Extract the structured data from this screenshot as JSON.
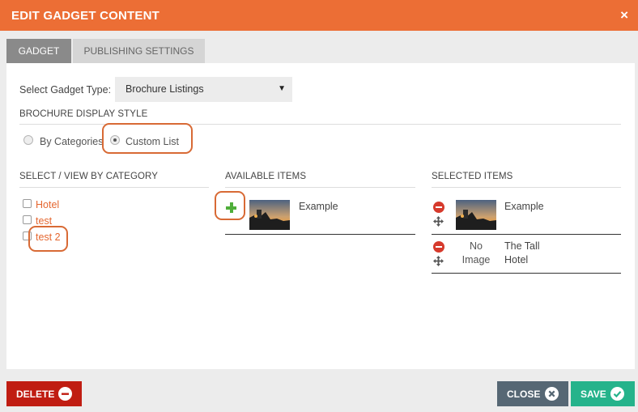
{
  "dialog": {
    "title": "EDIT GADGET CONTENT",
    "close_icon": "×"
  },
  "tabs": [
    {
      "label": "GADGET",
      "active": true
    },
    {
      "label": "PUBLISHING SETTINGS",
      "active": false
    }
  ],
  "gadget_type": {
    "label": "Select Gadget Type:",
    "value": "Brochure Listings"
  },
  "display_style": {
    "title": "BROCHURE DISPLAY STYLE",
    "options": [
      {
        "label": "By Categories",
        "checked": false
      },
      {
        "label": "Custom List",
        "checked": true
      }
    ]
  },
  "categories": {
    "title": "SELECT / VIEW BY CATEGORY",
    "items": [
      {
        "label": "Hotel",
        "checked": false
      },
      {
        "label": "test",
        "checked": false
      },
      {
        "label": "test 2",
        "checked": false
      }
    ]
  },
  "available": {
    "title": "AVAILABLE ITEMS",
    "items": [
      {
        "label": "Example",
        "has_image": true
      }
    ]
  },
  "selected": {
    "title": "SELECTED ITEMS",
    "items": [
      {
        "label": "Example",
        "has_image": true
      },
      {
        "label": "The Tall Hotel",
        "has_image": false,
        "no_image_text": "No Image"
      }
    ]
  },
  "footer": {
    "delete_label": "DELETE",
    "close_label": "CLOSE",
    "save_label": "SAVE"
  },
  "colors": {
    "header": "#ec6e35",
    "highlight": "#d86a35",
    "link": "#e5662f",
    "delete": "#c01d12",
    "close": "#566774",
    "save": "#25b38b",
    "add": "#4fae3a",
    "remove": "#d63a2c"
  }
}
